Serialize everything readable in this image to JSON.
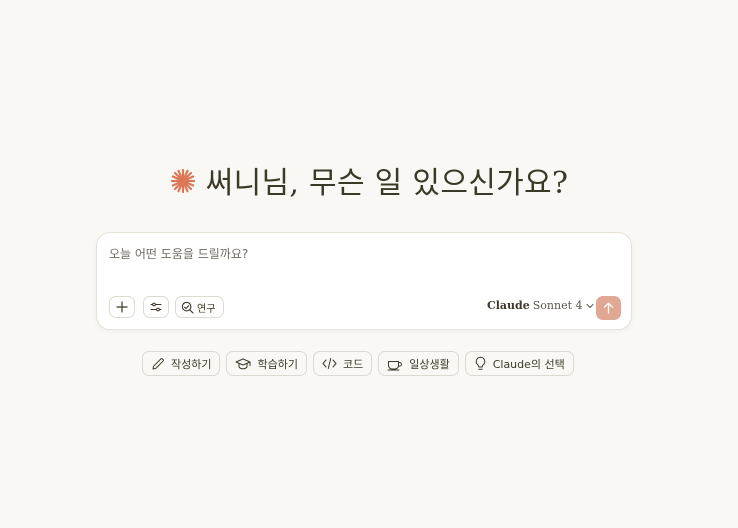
{
  "greeting": {
    "icon": "claude-spark-icon",
    "accent_color": "#d97757",
    "text": "써니님, 무슨 일 있으신가요?"
  },
  "composer": {
    "placeholder": "오늘 어떤 도움을 드릴까요?",
    "add_icon": "plus-icon",
    "tools_icon": "sliders-icon",
    "research_icon": "research-icon",
    "research_label": "연구",
    "model_brand": "Claude",
    "model_name": "Sonnet 4",
    "send_icon": "arrow-up-icon",
    "send_color": "#e0a893"
  },
  "chips": [
    {
      "icon": "pencil-icon",
      "label": "작성하기"
    },
    {
      "icon": "graduation-cap-icon",
      "label": "학습하기"
    },
    {
      "icon": "code-icon",
      "label": "코드"
    },
    {
      "icon": "coffee-cup-icon",
      "label": "일상생활"
    },
    {
      "icon": "lightbulb-icon",
      "label": "Claude의 선택"
    }
  ]
}
